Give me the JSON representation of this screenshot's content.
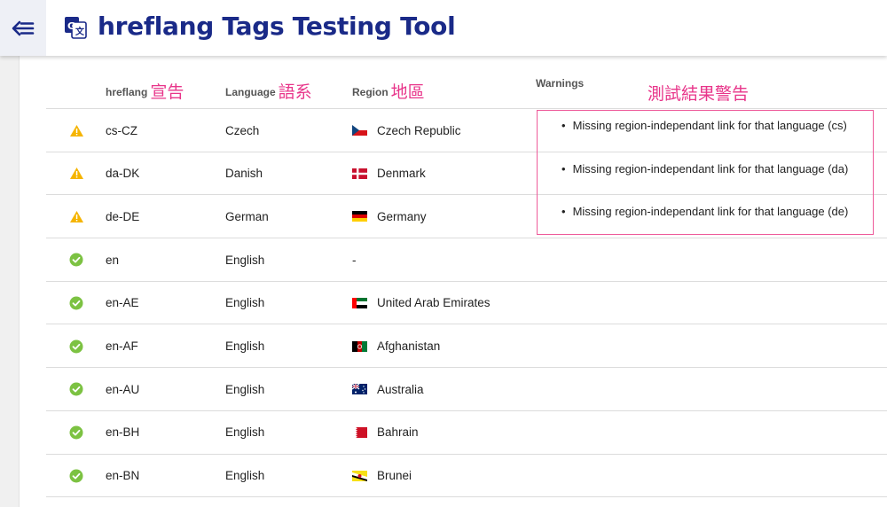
{
  "app": {
    "title": "hreflang Tags Testing Tool",
    "back_icon": "back-arrow-icon",
    "logo_icon": "translate-icon"
  },
  "table": {
    "headers": {
      "hreflang": "hreflang",
      "hreflang_zh": "宣告",
      "language": "Language",
      "language_zh": "語系",
      "region": "Region",
      "region_zh": "地區",
      "warnings": "Warnings",
      "warnings_zh": "測試結果警告"
    },
    "rows": [
      {
        "status": "warning",
        "code": "cs-CZ",
        "language": "Czech",
        "region": "Czech Republic",
        "flag": "cz",
        "warning": "Missing region-independant link for that language (cs)"
      },
      {
        "status": "warning",
        "code": "da-DK",
        "language": "Danish",
        "region": "Denmark",
        "flag": "dk",
        "warning": "Missing region-independant link for that language (da)"
      },
      {
        "status": "warning",
        "code": "de-DE",
        "language": "German",
        "region": "Germany",
        "flag": "de",
        "warning": "Missing region-independant link for that language (de)"
      },
      {
        "status": "ok",
        "code": "en",
        "language": "English",
        "region": "-",
        "flag": "",
        "warning": ""
      },
      {
        "status": "ok",
        "code": "en-AE",
        "language": "English",
        "region": "United Arab Emirates",
        "flag": "ae",
        "warning": ""
      },
      {
        "status": "ok",
        "code": "en-AF",
        "language": "English",
        "region": "Afghanistan",
        "flag": "af",
        "warning": ""
      },
      {
        "status": "ok",
        "code": "en-AU",
        "language": "English",
        "region": "Australia",
        "flag": "au",
        "warning": ""
      },
      {
        "status": "ok",
        "code": "en-BH",
        "language": "English",
        "region": "Bahrain",
        "flag": "bh",
        "warning": ""
      },
      {
        "status": "ok",
        "code": "en-BN",
        "language": "English",
        "region": "Brunei",
        "flag": "bn",
        "warning": ""
      }
    ]
  },
  "colors": {
    "title": "#1a2a88",
    "warning": "#f5b400",
    "ok": "#7cc242",
    "annotation": "#e8358a"
  }
}
